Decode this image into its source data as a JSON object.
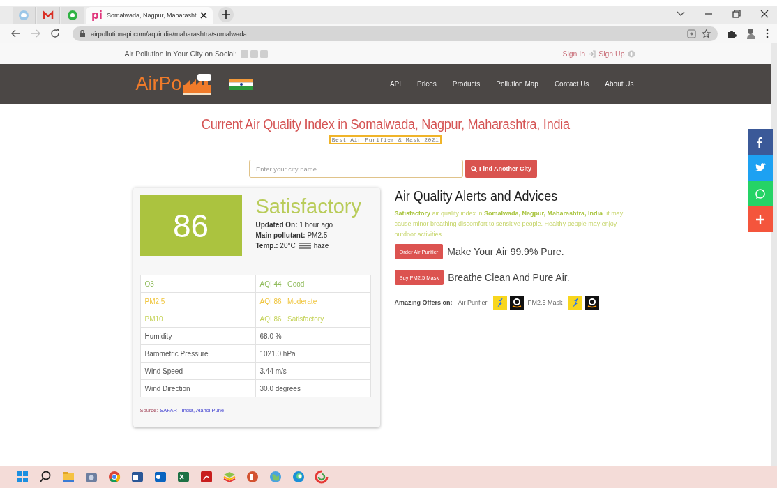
{
  "browser": {
    "tabs": [
      {
        "kind": "pinned",
        "selected": false
      },
      {
        "kind": "pinned",
        "selected": false
      },
      {
        "kind": "pinned",
        "selected": false
      },
      {
        "kind": "page",
        "favicon": "pi",
        "label": "Somalwada, Nagpur, Maharasht",
        "selected": true
      }
    ],
    "url": "airpollutionapi.com/aqi/india/maharashtra/somalwada"
  },
  "topbar": {
    "social_label": "Air Pollution in Your City on Social:",
    "sign_in": "Sign In",
    "sign_up": "Sign Up"
  },
  "navbar": {
    "logo": "AirPo",
    "menu": [
      {
        "label": "API",
        "selected": false
      },
      {
        "label": "Prices",
        "selected": false
      },
      {
        "label": "Products",
        "selected": false
      },
      {
        "label": "Pollution Map",
        "selected": false
      },
      {
        "label": "Contact Us",
        "selected": false
      },
      {
        "label": "About Us",
        "selected": false
      }
    ]
  },
  "title": "Current Air Quality Index in Somalwada, Nagpur, Maharashtra, India",
  "promo": "Best Air Purifier & Mask 2021",
  "search": {
    "placeholder": "Enter your city name",
    "button": "Find Another City"
  },
  "aqi": {
    "value": "86",
    "color": "#abc33f",
    "category": "Satisfactory",
    "details": [
      {
        "label": "Updated On:",
        "value": "1 hour ago"
      },
      {
        "label": "Main pollutant:",
        "value": "PM2.5"
      },
      {
        "label": "Temp.:",
        "value": "20°C",
        "extra": "haze"
      }
    ]
  },
  "table": {
    "rows": [
      {
        "name": "O3",
        "value": "AQI 44   Good",
        "color": "#8fbb5a"
      },
      {
        "name": "PM2.5",
        "value": "AQI 86   Moderate",
        "color": "#f0c53c"
      },
      {
        "name": "PM10",
        "value": "AQI 86   Satisfactory",
        "color": "#c6d35a"
      },
      {
        "name": "Humidity",
        "value": "68.0 %"
      },
      {
        "name": "Barometric Pressure",
        "value": "1021.0 hPa"
      },
      {
        "name": "Wind Speed",
        "value": "3.44 m/s"
      },
      {
        "name": "Wind Direction",
        "value": "30.0 degrees"
      }
    ]
  },
  "source": {
    "label": "Source:",
    "link": "SAFAR - India, Alandi Pune"
  },
  "alerts": {
    "heading": "Air Quality Alerts and Advices",
    "text": "**Satisfactory** air quality index in **Somalwada, Nagpur, Maharashtra, India**. it may cause minor breathing discomfort to sensitive people. Healthy people may enjoy outdoor activities.",
    "actions": [
      {
        "button": "Order Air Purifier",
        "tagline": "Make Your Air 99.9% Pure."
      },
      {
        "button": "Buy PM2.5 Mask",
        "tagline": "Breathe Clean And Pure Air."
      }
    ],
    "offers": {
      "label": "Amazing Offers on:",
      "items": [
        "Air Purifier",
        "PM2.5 Mask"
      ]
    }
  }
}
